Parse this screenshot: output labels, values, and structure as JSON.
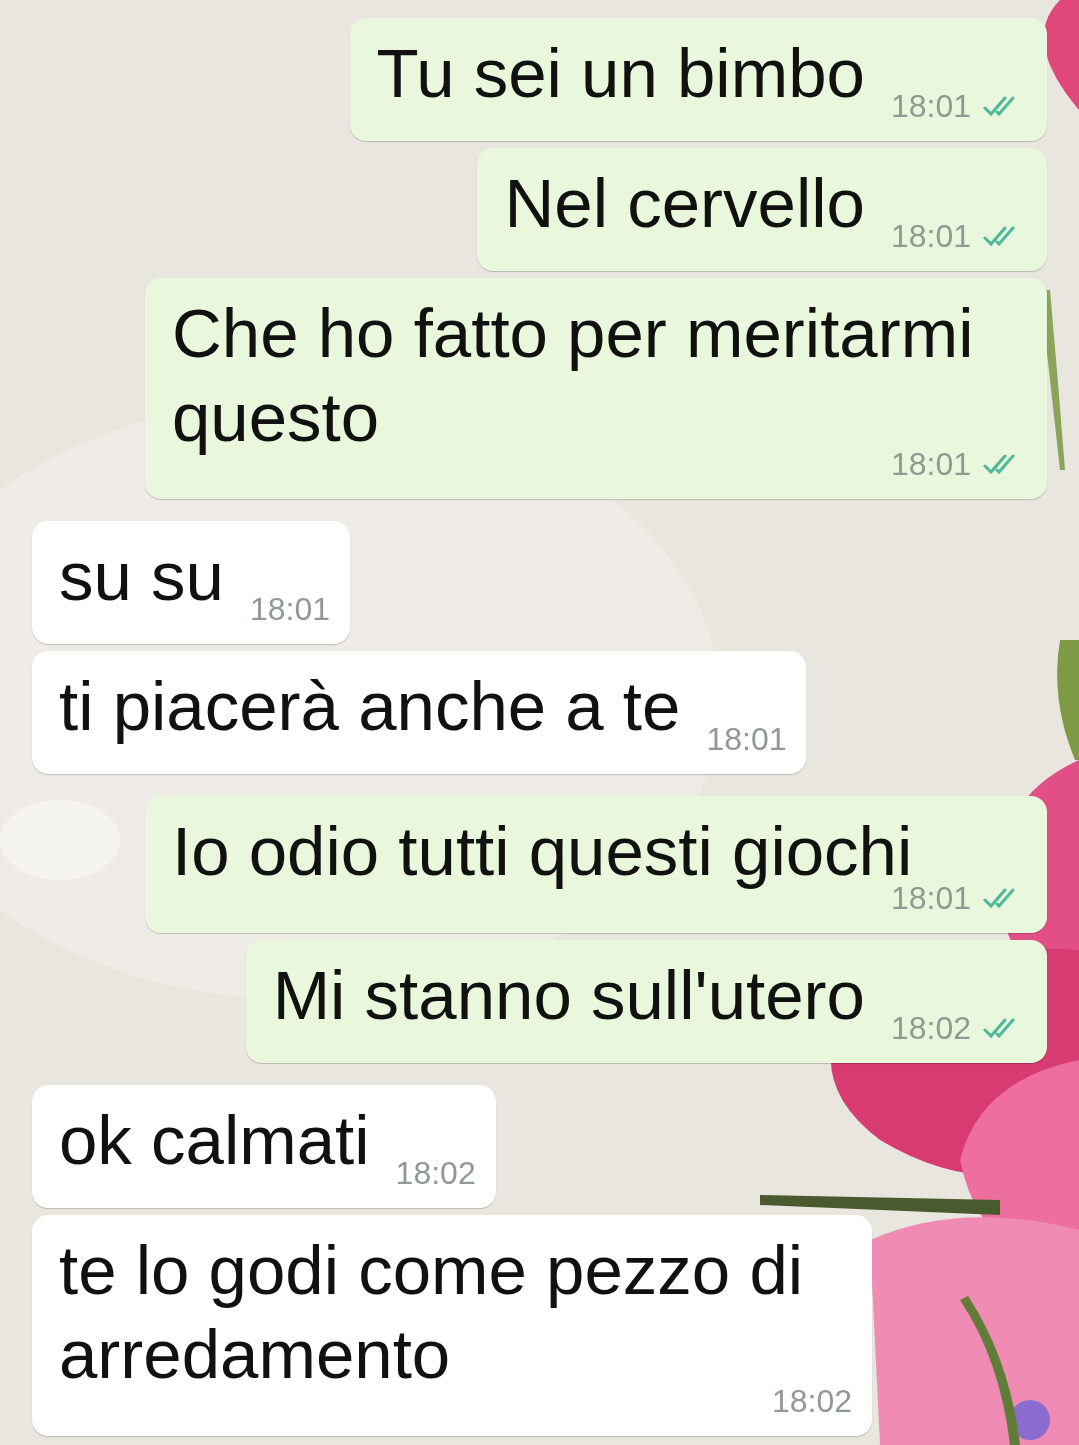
{
  "messages": [
    {
      "kind": "out",
      "text": "Tu sei un bimbo",
      "time": "18:01",
      "read": true
    },
    {
      "kind": "out",
      "text": "Nel cervello",
      "time": "18:01",
      "read": true
    },
    {
      "kind": "out",
      "text": "Che ho fatto per meritarmi questo",
      "time": "18:01",
      "read": true
    },
    {
      "kind": "in",
      "text": "su su",
      "time": "18:01"
    },
    {
      "kind": "in",
      "text": "ti piacerà anche a te",
      "time": "18:01"
    },
    {
      "kind": "out",
      "text": "Io odio tutti questi giochi",
      "time": "18:01",
      "read": true
    },
    {
      "kind": "out",
      "text": "Mi stanno sull'utero",
      "time": "18:02",
      "read": true
    },
    {
      "kind": "in",
      "text": "ok calmati",
      "time": "18:02"
    },
    {
      "kind": "in",
      "text": "te lo godi come pezzo di arredamento",
      "time": "18:02"
    }
  ]
}
